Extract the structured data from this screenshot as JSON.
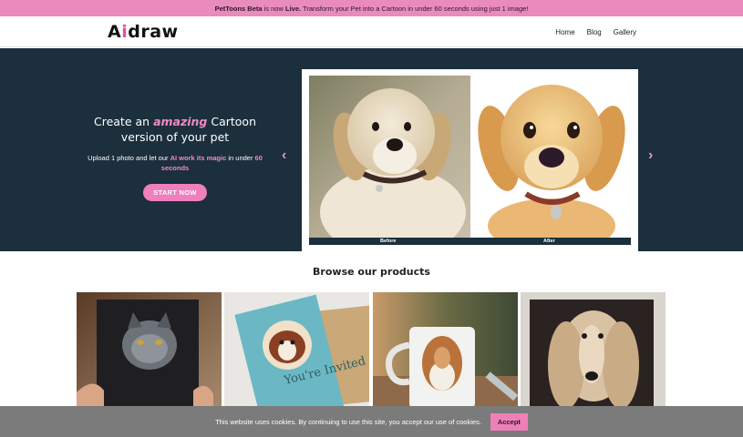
{
  "announcement": {
    "brand": "PetToons Beta",
    "text_mid": " is now ",
    "live": "Live.",
    "text_end": " Transform your Pet into a Cartoon in under 60 seconds using just 1 image!"
  },
  "nav": {
    "logo_a": "A",
    "logo_i": "i",
    "logo_rest": "draw",
    "links": [
      "Home",
      "Blog",
      "Gallery"
    ]
  },
  "hero": {
    "title_pre": "Create an ",
    "title_em": "amazing",
    "title_post": " Cartoon version of your pet",
    "sub_pre": "Upload 1 photo and let our ",
    "sub_em1": "AI work its magic",
    "sub_mid": " in under ",
    "sub_em2": "60 seconds",
    "cta": "START NOW",
    "before_label": "Before",
    "after_label": "After",
    "prev_arrow": "‹",
    "next_arrow": "›"
  },
  "products_section": {
    "title": "Browse our products",
    "items": [
      {
        "icon": "notebook-cat-image"
      },
      {
        "icon": "invitation-card-dog-image",
        "card_text": "You're Invited"
      },
      {
        "icon": "mug-collie-image"
      },
      {
        "icon": "canvas-afghan-hound-image"
      }
    ]
  },
  "cookie": {
    "text": "This website uses cookies. By continuing to use this site, you accept our use of cookies.",
    "accept": "Accept"
  },
  "colors": {
    "accent_pink": "#ee7fb9",
    "hero_bg": "#1b2f3c",
    "cookie_bg": "#7b7b7b"
  }
}
